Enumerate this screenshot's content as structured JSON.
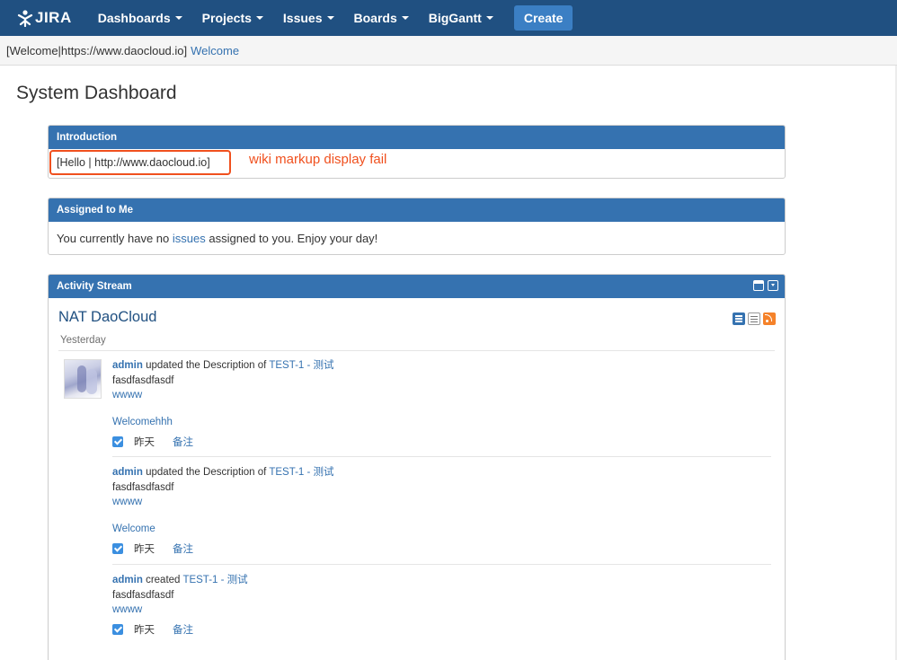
{
  "nav": {
    "logo_text": "JIRA",
    "items": [
      {
        "label": "Dashboards"
      },
      {
        "label": "Projects"
      },
      {
        "label": "Issues"
      },
      {
        "label": "Boards"
      },
      {
        "label": "BigGantt"
      }
    ],
    "create_label": "Create"
  },
  "banner": {
    "text": "[Welcome|https://www.daocloud.io]",
    "link": "Welcome"
  },
  "page": {
    "title": "System Dashboard"
  },
  "intro": {
    "header": "Introduction",
    "content": "[Hello | http://www.daocloud.io]",
    "annotation": "wiki markup display fail"
  },
  "assigned": {
    "header": "Assigned to Me",
    "text_before": "You currently have no",
    "link": "issues",
    "text_after": "assigned to you. Enjoy your day!"
  },
  "activity": {
    "header": "Activity Stream",
    "title": "NAT DaoCloud",
    "day_label": "Yesterday",
    "entries": [
      {
        "user": "admin",
        "action": "updated the Description of",
        "issue": "TEST-1 - 测试",
        "desc": "fasdfasdfasdf",
        "wwww": "wwww",
        "welcome": "Welcomehhh",
        "time": "昨天",
        "comment": "备注"
      },
      {
        "user": "admin",
        "action": "updated the Description of",
        "issue": "TEST-1 - 测试",
        "desc": "fasdfasdfasdf",
        "wwww": "wwww",
        "welcome": "Welcome",
        "time": "昨天",
        "comment": "备注"
      },
      {
        "user": "admin",
        "action": "created",
        "issue": "TEST-1 - 测试",
        "desc": "fasdfasdfasdf",
        "wwww": "wwww",
        "time": "昨天",
        "comment": "备注"
      }
    ]
  },
  "colors": {
    "nav_bg": "#205081",
    "header_bg": "#3572b0",
    "link": "#3572b0",
    "annotation": "#f0501e",
    "create_btn": "#3b7fc4"
  }
}
